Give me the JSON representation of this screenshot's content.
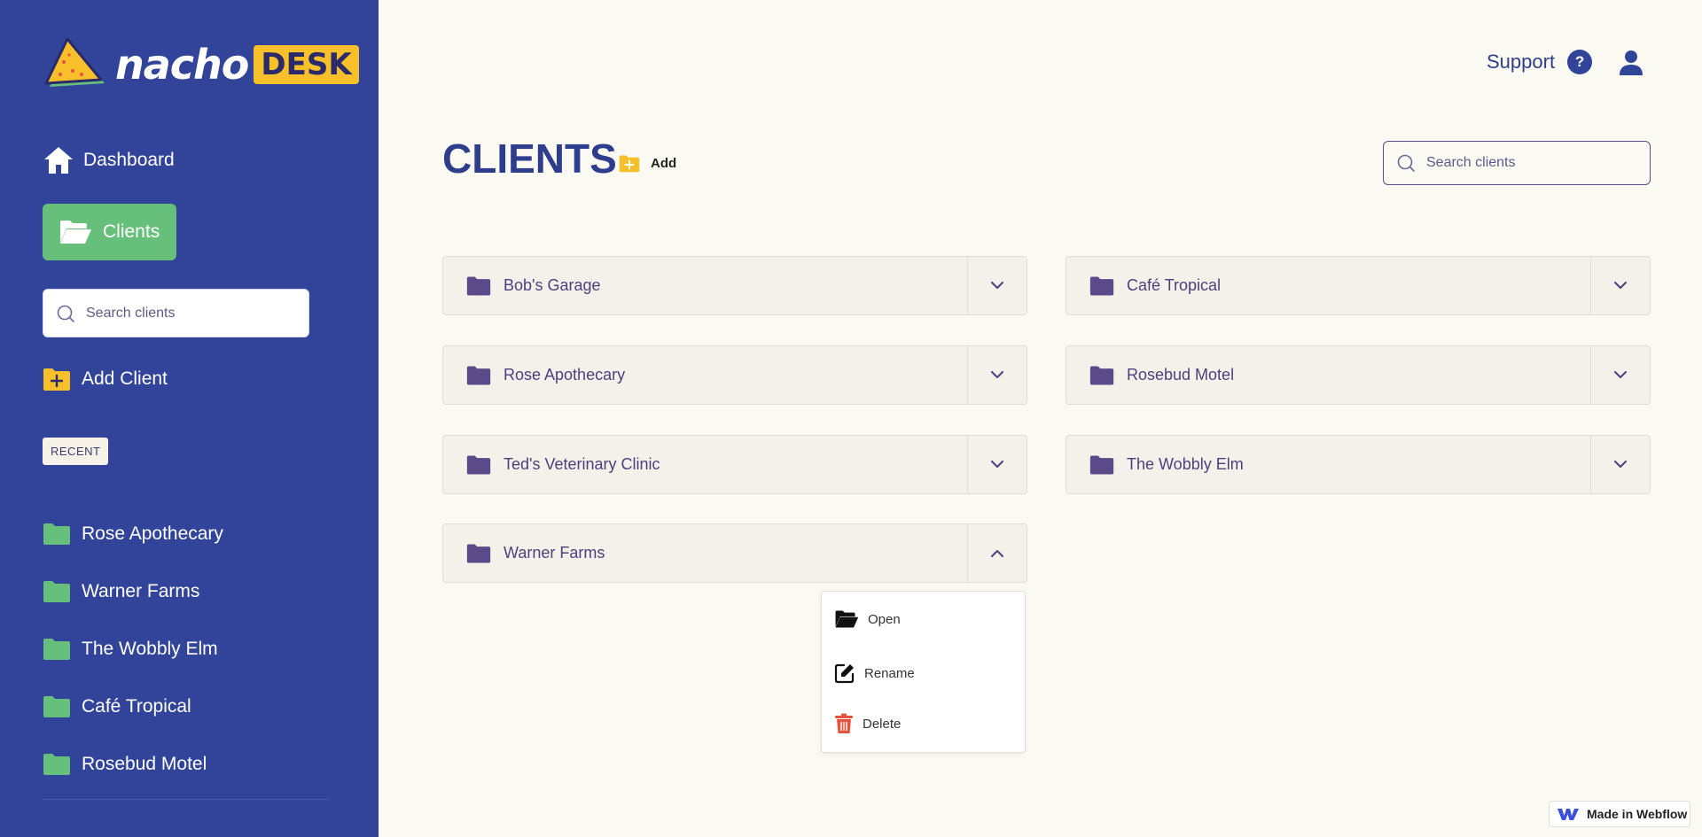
{
  "app": {
    "logo_text": "nacho",
    "logo_badge": "DESK"
  },
  "sidebar": {
    "nav": [
      {
        "label": "Dashboard",
        "icon": "home-icon"
      },
      {
        "label": "Clients",
        "icon": "folder-open-icon",
        "active": true
      }
    ],
    "search_placeholder": "Search clients",
    "add_client_label": "Add Client",
    "recent_label": "RECENT",
    "recent": [
      {
        "label": "Rose Apothecary"
      },
      {
        "label": "Warner Farms"
      },
      {
        "label": "The Wobbly Elm"
      },
      {
        "label": "Café Tropical"
      },
      {
        "label": "Rosebud Motel"
      }
    ]
  },
  "header": {
    "support_label": "Support",
    "help_glyph": "?"
  },
  "main": {
    "title": "CLIENTS",
    "add_label": "Add",
    "search_placeholder": "Search clients",
    "clients": [
      {
        "name": "Bob's Garage",
        "expanded": false
      },
      {
        "name": "Café Tropical",
        "expanded": false
      },
      {
        "name": "Rose Apothecary",
        "expanded": false
      },
      {
        "name": "Rosebud Motel",
        "expanded": false
      },
      {
        "name": "Ted's Veterinary Clinic",
        "expanded": false
      },
      {
        "name": "The Wobbly Elm",
        "expanded": false
      },
      {
        "name": "Warner Farms",
        "expanded": true
      }
    ],
    "menu": {
      "open_label": "Open",
      "rename_label": "Rename",
      "delete_label": "Delete"
    }
  },
  "badge": {
    "webflow_label": "Made in Webflow"
  },
  "colors": {
    "sidebar_bg": "#31449a",
    "accent_green": "#66c07b",
    "accent_yellow": "#f7c02b",
    "folder_purple": "#5a4a8a",
    "danger_red": "#e5533d"
  }
}
